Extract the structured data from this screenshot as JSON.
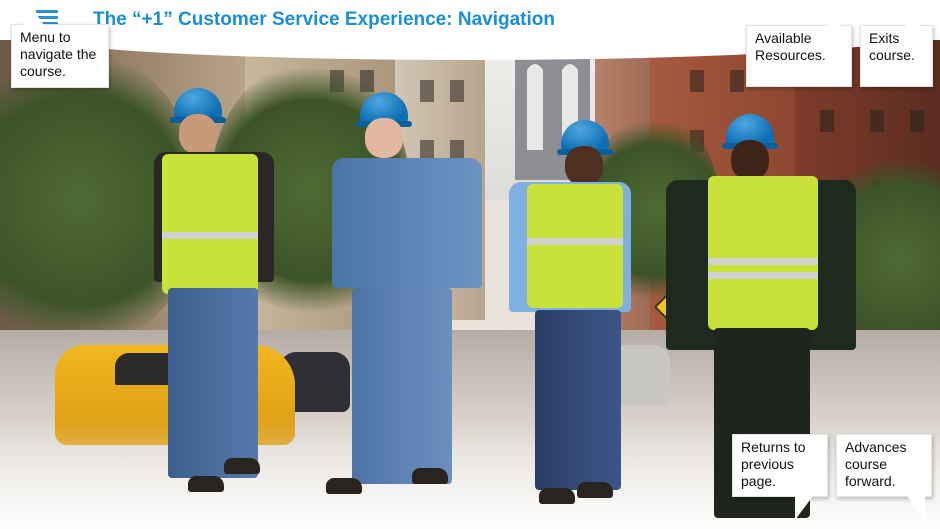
{
  "header": {
    "title": "The “+1” Customer Service Experience: Navigation",
    "menu_icon": "hamburger-menu-icon",
    "accent_color": "#1a8ed6"
  },
  "callouts": {
    "menu": "Menu to navigate the course.",
    "resources": "Available Resources.",
    "exits": "Exits course.",
    "returns": "Returns to previous page.",
    "advances": "Advances course forward."
  }
}
